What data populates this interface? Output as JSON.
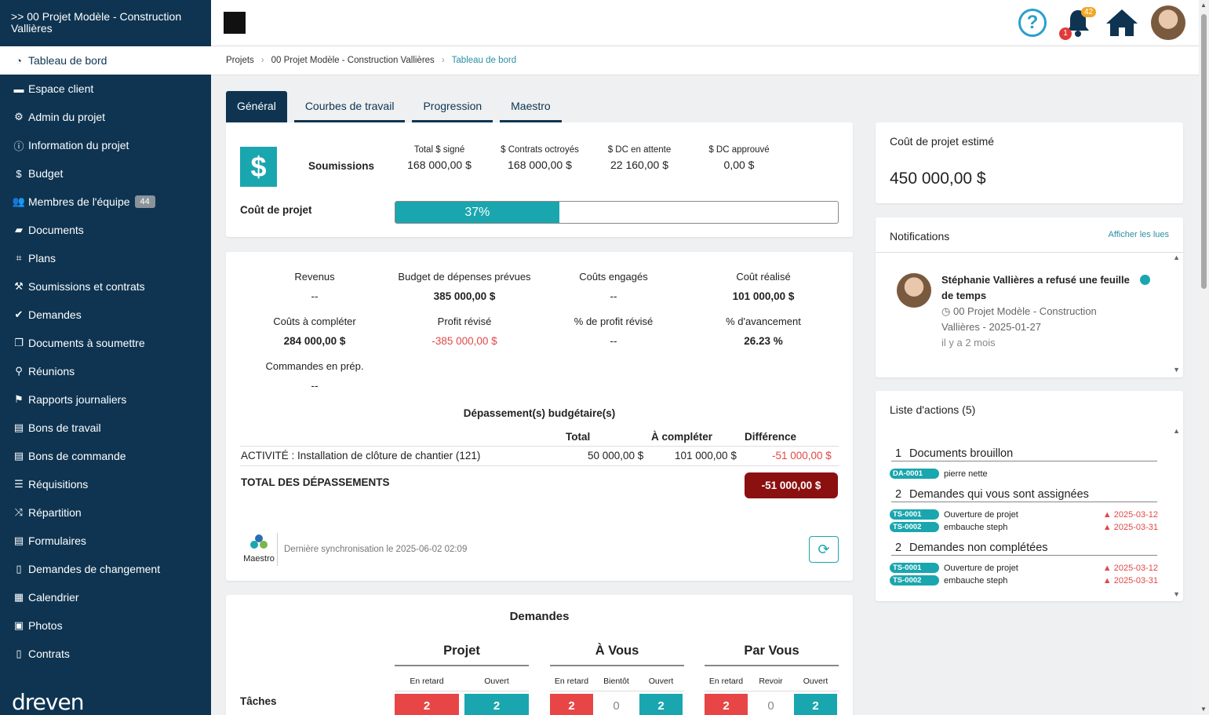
{
  "sidebar": {
    "project_title": ">> 00 Projet Modèle - Construction Vallières",
    "items": [
      {
        "label": "Tableau de bord",
        "icon": "dashboard-icon",
        "glyph": "◔"
      },
      {
        "label": "Espace client",
        "icon": "briefcase-icon",
        "glyph": "▬"
      },
      {
        "label": "Admin du projet",
        "icon": "gear-icon",
        "glyph": "⚙"
      },
      {
        "label": "Information du projet",
        "icon": "info-icon",
        "glyph": "ⓘ"
      },
      {
        "label": "Budget",
        "icon": "dollar-icon",
        "glyph": "$"
      },
      {
        "label": "Membres de l'équipe",
        "icon": "users-icon",
        "glyph": "👥",
        "badge": "44"
      },
      {
        "label": "Documents",
        "icon": "folder-icon",
        "glyph": "▰"
      },
      {
        "label": "Plans",
        "icon": "crop-icon",
        "glyph": "⌗"
      },
      {
        "label": "Soumissions et contrats",
        "icon": "hammer-icon",
        "glyph": "⚒"
      },
      {
        "label": "Demandes",
        "icon": "check-icon",
        "glyph": "✔"
      },
      {
        "label": "Documents à soumettre",
        "icon": "copy-icon",
        "glyph": "❐"
      },
      {
        "label": "Réunions",
        "icon": "map-marker-icon",
        "glyph": "⚲"
      },
      {
        "label": "Rapports journaliers",
        "icon": "flag-icon",
        "glyph": "⚑"
      },
      {
        "label": "Bons de travail",
        "icon": "file-icon",
        "glyph": "▤"
      },
      {
        "label": "Bons de commande",
        "icon": "file-icon",
        "glyph": "▤"
      },
      {
        "label": "Réquisitions",
        "icon": "list-icon",
        "glyph": "☰"
      },
      {
        "label": "Répartition",
        "icon": "shuffle-icon",
        "glyph": "⤨"
      },
      {
        "label": "Formulaires",
        "icon": "file-lines-icon",
        "glyph": "▤"
      },
      {
        "label": "Demandes de changement",
        "icon": "file-outline-icon",
        "glyph": "▯"
      },
      {
        "label": "Calendrier",
        "icon": "calendar-icon",
        "glyph": "▦"
      },
      {
        "label": "Photos",
        "icon": "image-icon",
        "glyph": "▣"
      },
      {
        "label": "Contrats",
        "icon": "file-outline-icon",
        "glyph": "▯"
      }
    ],
    "brand": "dreven"
  },
  "topbar": {
    "help": "?",
    "notif_count": "42",
    "alert_count": "1"
  },
  "breadcrumb": {
    "items": [
      "Projets",
      "00 Projet Modèle - Construction Vallières"
    ],
    "current": "Tableau de bord"
  },
  "tabs": [
    "Général",
    "Courbes de travail",
    "Progression",
    "Maestro"
  ],
  "soumissions": {
    "label": "Soumissions",
    "cols": [
      {
        "label": "Total $ signé",
        "value": "168 000,00 $"
      },
      {
        "label": "$ Contrats octroyés",
        "value": "168 000,00 $"
      },
      {
        "label": "$ DC en attente",
        "value": "22 160,00 $"
      },
      {
        "label": "$ DC approuvé",
        "value": "0,00 $"
      }
    ],
    "cout_label": "Coût de projet",
    "progress_pct": 37,
    "progress_text": "37%"
  },
  "finance": {
    "cells": [
      {
        "label": "Revenus",
        "value": "--",
        "style": "plain"
      },
      {
        "label": "Budget de dépenses prévues",
        "value": "385 000,00 $",
        "style": "bold"
      },
      {
        "label": "Coûts engagés",
        "value": "--",
        "style": "plain"
      },
      {
        "label": "Coût réalisé",
        "value": "101 000,00 $",
        "style": "bold"
      },
      {
        "label": "Coûts à compléter",
        "value": "284 000,00 $",
        "style": "bold"
      },
      {
        "label": "Profit révisé",
        "value": "-385 000,00 $",
        "style": "neg"
      },
      {
        "label": "% de profit révisé",
        "value": "--",
        "style": "plain"
      },
      {
        "label": "% d'avancement",
        "value": "26.23 %",
        "style": "bold"
      },
      {
        "label": "Commandes en prép.",
        "value": "--",
        "style": "plain"
      }
    ],
    "depassement": {
      "title": "Dépassement(s) budgétaire(s)",
      "headers": [
        "Total",
        "À compléter",
        "Différence"
      ],
      "row": {
        "activity": "ACTIVITÉ : Installation de clôture de chantier (121)",
        "total": "50 000,00 $",
        "a_completer": "101 000,00 $",
        "difference": "-51 000,00 $"
      },
      "total_label": "TOTAL DES DÉPASSEMENTS",
      "total_value": "-51 000,00 $"
    },
    "maestro_label": "Maestro",
    "sync_text": "Dernière synchronisation le 2025-06-02 02:09"
  },
  "demandes": {
    "title": "Demandes",
    "groups": [
      {
        "name": "Projet",
        "subs": [
          {
            "label": "En retard",
            "value": "2",
            "color": "red"
          },
          {
            "label": "Ouvert",
            "value": "2",
            "color": "teal"
          }
        ]
      },
      {
        "name": "À Vous",
        "subs": [
          {
            "label": "En retard",
            "value": "2",
            "color": "red"
          },
          {
            "label": "Bientôt",
            "value": "0",
            "color": "none"
          },
          {
            "label": "Ouvert",
            "value": "2",
            "color": "teal"
          }
        ]
      },
      {
        "name": "Par Vous",
        "subs": [
          {
            "label": "En retard",
            "value": "2",
            "color": "red"
          },
          {
            "label": "Revoir",
            "value": "0",
            "color": "none"
          },
          {
            "label": "Ouvert",
            "value": "2",
            "color": "teal"
          }
        ]
      }
    ],
    "row_label": "Tâches"
  },
  "cout_estime": {
    "title": "Coût de projet estimé",
    "value": "450 000,00 $"
  },
  "notifications": {
    "title": "Notifications",
    "show_read": "Afficher les lues",
    "item": {
      "text": "Stéphanie Vallières a refusé une feuille de temps",
      "meta": "00 Projet Modèle - Construction Vallières - 2025-01-27",
      "ago": "il y a 2 mois"
    }
  },
  "actions": {
    "title": "Liste d'actions (5)",
    "sections": [
      {
        "count": "1",
        "title": "Documents brouillon",
        "rows": [
          {
            "code": "DA-0001",
            "label": "pierre nette",
            "due": ""
          }
        ]
      },
      {
        "count": "2",
        "title": "Demandes qui vous sont assignées",
        "rows": [
          {
            "code": "TS-0001",
            "label": "Ouverture de projet",
            "due": "2025-03-12"
          },
          {
            "code": "TS-0002",
            "label": "embauche steph",
            "due": "2025-03-31"
          }
        ]
      },
      {
        "count": "2",
        "title": "Demandes non complétées",
        "rows": [
          {
            "code": "TS-0001",
            "label": "Ouverture de projet",
            "due": "2025-03-12"
          },
          {
            "code": "TS-0002",
            "label": "embauche steph",
            "due": "2025-03-31"
          }
        ]
      }
    ]
  },
  "colors": {
    "sidebar": "#0e3451",
    "teal": "#1aa6ae",
    "red": "#e84646",
    "dark_red": "#8b1010"
  }
}
